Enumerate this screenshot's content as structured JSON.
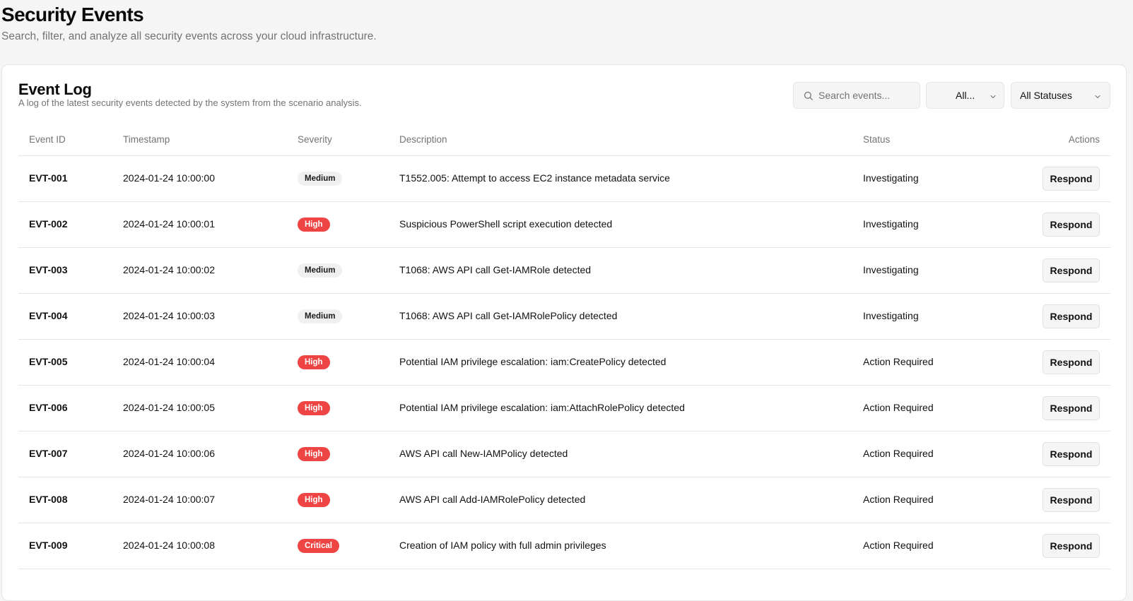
{
  "page": {
    "title": "Security Events",
    "subtitle": "Search, filter, and analyze all security events across your cloud infrastructure."
  },
  "card": {
    "title": "Event Log",
    "description": "A log of the latest security events detected by the system from the scenario analysis."
  },
  "filters": {
    "search_placeholder": "Search events...",
    "severity_value": "All...",
    "status_value": "All Statuses"
  },
  "table": {
    "headers": {
      "id": "Event ID",
      "timestamp": "Timestamp",
      "severity": "Severity",
      "description": "Description",
      "status": "Status",
      "actions": "Actions"
    },
    "action_label": "Respond",
    "rows": [
      {
        "id": "EVT-001",
        "timestamp": "2024-01-24 10:00:00",
        "severity": "Medium",
        "description": "T1552.005: Attempt to access EC2 instance metadata service",
        "status": "Investigating"
      },
      {
        "id": "EVT-002",
        "timestamp": "2024-01-24 10:00:01",
        "severity": "High",
        "description": "Suspicious PowerShell script execution detected",
        "status": "Investigating"
      },
      {
        "id": "EVT-003",
        "timestamp": "2024-01-24 10:00:02",
        "severity": "Medium",
        "description": "T1068: AWS API call Get-IAMRole detected",
        "status": "Investigating"
      },
      {
        "id": "EVT-004",
        "timestamp": "2024-01-24 10:00:03",
        "severity": "Medium",
        "description": "T1068: AWS API call Get-IAMRolePolicy detected",
        "status": "Investigating"
      },
      {
        "id": "EVT-005",
        "timestamp": "2024-01-24 10:00:04",
        "severity": "High",
        "description": "Potential IAM privilege escalation: iam:CreatePolicy detected",
        "status": "Action Required"
      },
      {
        "id": "EVT-006",
        "timestamp": "2024-01-24 10:00:05",
        "severity": "High",
        "description": "Potential IAM privilege escalation: iam:AttachRolePolicy detected",
        "status": "Action Required"
      },
      {
        "id": "EVT-007",
        "timestamp": "2024-01-24 10:00:06",
        "severity": "High",
        "description": "AWS API call New-IAMPolicy detected",
        "status": "Action Required"
      },
      {
        "id": "EVT-008",
        "timestamp": "2024-01-24 10:00:07",
        "severity": "High",
        "description": "AWS API call Add-IAMRolePolicy detected",
        "status": "Action Required"
      },
      {
        "id": "EVT-009",
        "timestamp": "2024-01-24 10:00:08",
        "severity": "Critical",
        "description": "Creation of IAM policy with full admin privileges",
        "status": "Action Required"
      }
    ]
  },
  "colors": {
    "high": "#ef4444",
    "critical": "#ef4444",
    "medium_bg": "#f0f0f0"
  }
}
